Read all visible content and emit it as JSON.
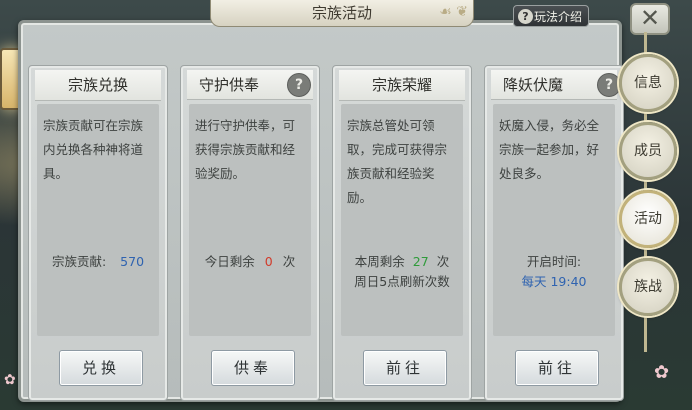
{
  "window": {
    "title": "宗族活动",
    "help_label": "玩法介绍",
    "help_icon": "?",
    "close_icon": "✕"
  },
  "side_tabs": [
    {
      "label": "信息",
      "active": false
    },
    {
      "label": "成员",
      "active": false
    },
    {
      "label": "活动",
      "active": true
    },
    {
      "label": "族战",
      "active": false
    }
  ],
  "cards": [
    {
      "title": "宗族兑换",
      "desc": "宗族贡献可在宗族内兑换各种神将道具。",
      "stat1_label": "宗族贡献:",
      "stat1_value": "570",
      "button": "兑换"
    },
    {
      "title": "守护供奉",
      "desc": "进行守护供奉，可获得宗族贡献和经验奖励。",
      "stat1_label": "今日剩余",
      "stat1_value": "0",
      "stat1_suffix": "次",
      "button": "供奉"
    },
    {
      "title": "宗族荣耀",
      "desc": "宗族总管处可领取，完成可获得宗族贡献和经验奖励。",
      "stat1_label": "本周剩余",
      "stat1_value": "27",
      "stat1_suffix": "次",
      "stat2": "周日5点刷新次数",
      "button": "前往"
    },
    {
      "title": "降妖伏魔",
      "desc": "妖魔入侵，务必全宗族一起参加，好处良多。",
      "stat1_label": "开启时间:",
      "stat2": "每天 19:40",
      "button": "前往"
    }
  ],
  "colors": {
    "contribution": "#2f63b0",
    "zero": "#d13a2a",
    "remaining": "#2f9b3a"
  }
}
